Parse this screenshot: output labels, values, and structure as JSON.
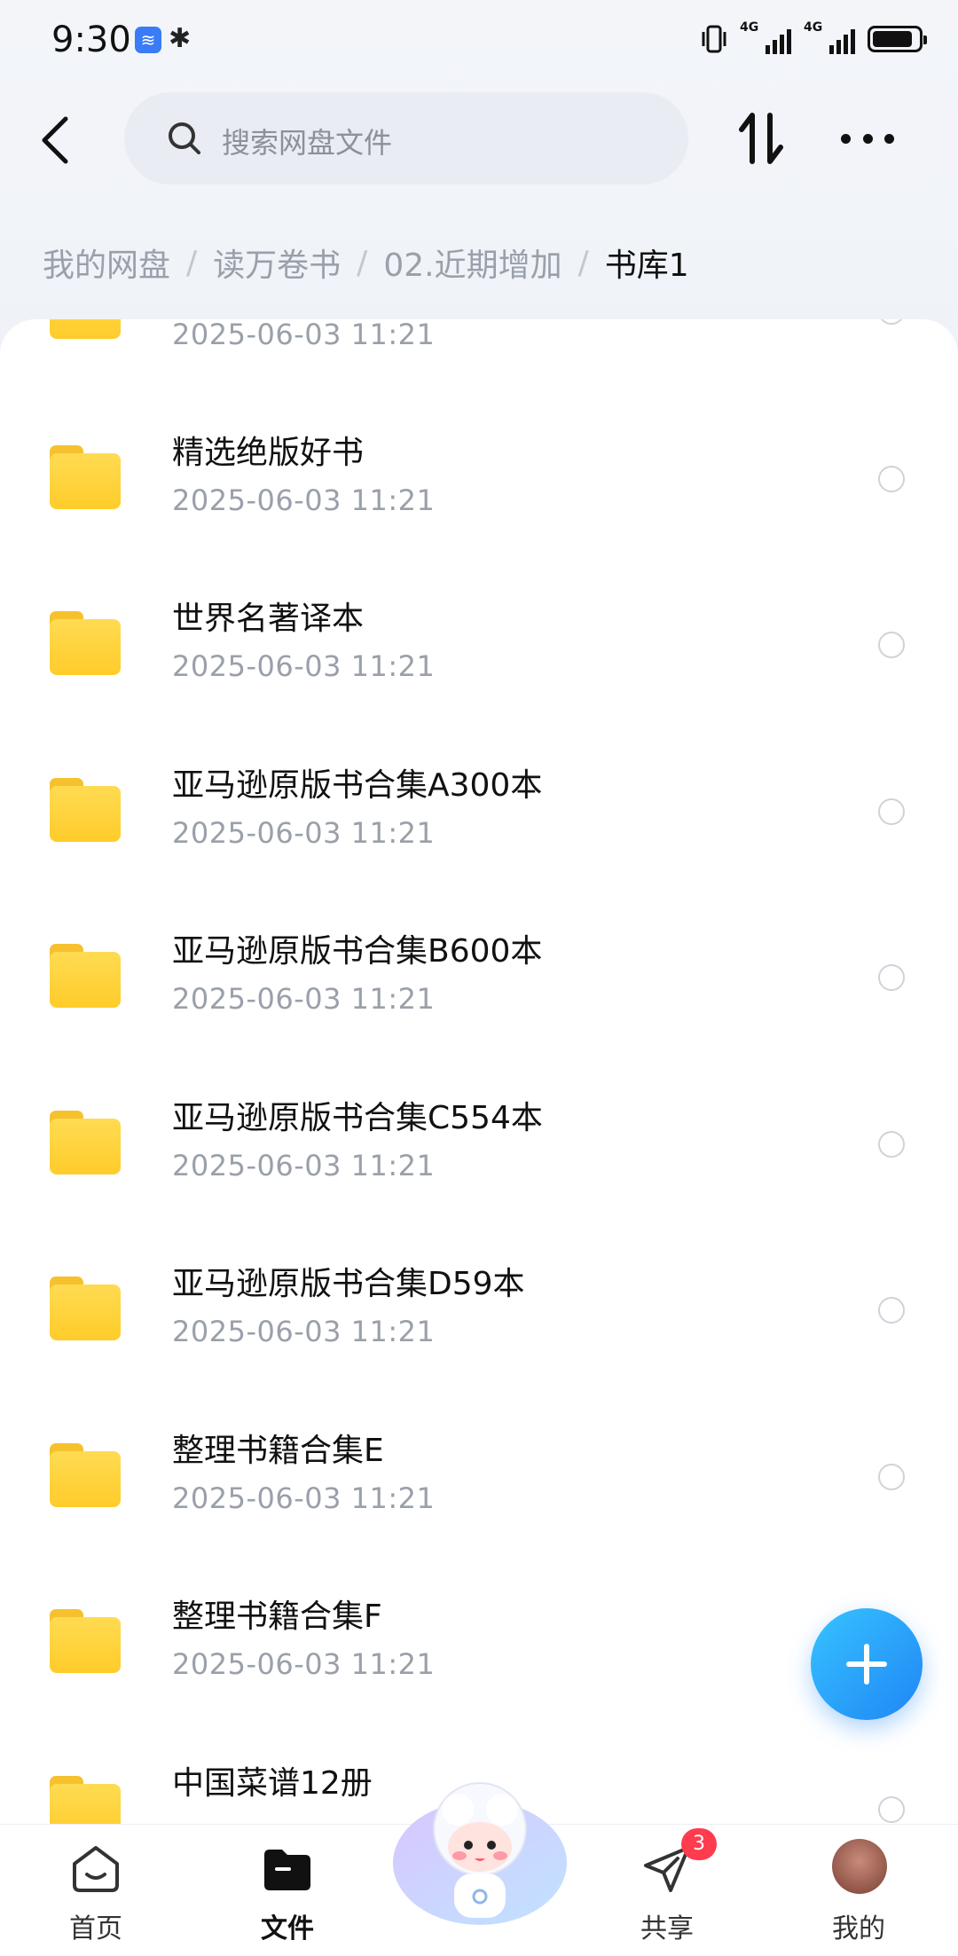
{
  "status_bar": {
    "time": "9:30",
    "net_label": "4G"
  },
  "search": {
    "placeholder": "搜索网盘文件"
  },
  "breadcrumb": {
    "items": [
      "我的网盘",
      "读万卷书",
      "02.近期增加"
    ],
    "current": "书库1",
    "separator": "/"
  },
  "files": [
    {
      "name": "",
      "date": "2025-06-03  11:21"
    },
    {
      "name": "精选绝版好书",
      "date": "2025-06-03  11:21"
    },
    {
      "name": "世界名著译本",
      "date": "2025-06-03  11:21"
    },
    {
      "name": "亚马逊原版书合集A300本",
      "date": "2025-06-03  11:21"
    },
    {
      "name": "亚马逊原版书合集B600本",
      "date": "2025-06-03  11:21"
    },
    {
      "name": "亚马逊原版书合集C554本",
      "date": "2025-06-03  11:21"
    },
    {
      "name": "亚马逊原版书合集D59本",
      "date": "2025-06-03  11:21"
    },
    {
      "name": "整理书籍合集E",
      "date": "2025-06-03  11:21"
    },
    {
      "name": "整理书籍合集F",
      "date": "2025-06-03  11:21"
    },
    {
      "name": "中国菜谱12册",
      "date": ""
    }
  ],
  "bottom_nav": {
    "home": "首页",
    "files": "文件",
    "share": "共享",
    "mine": "我的",
    "share_badge": "3"
  },
  "colors": {
    "accent": "#1f86f5",
    "folder": "#ffd23f",
    "badge": "#ff3b4e"
  }
}
